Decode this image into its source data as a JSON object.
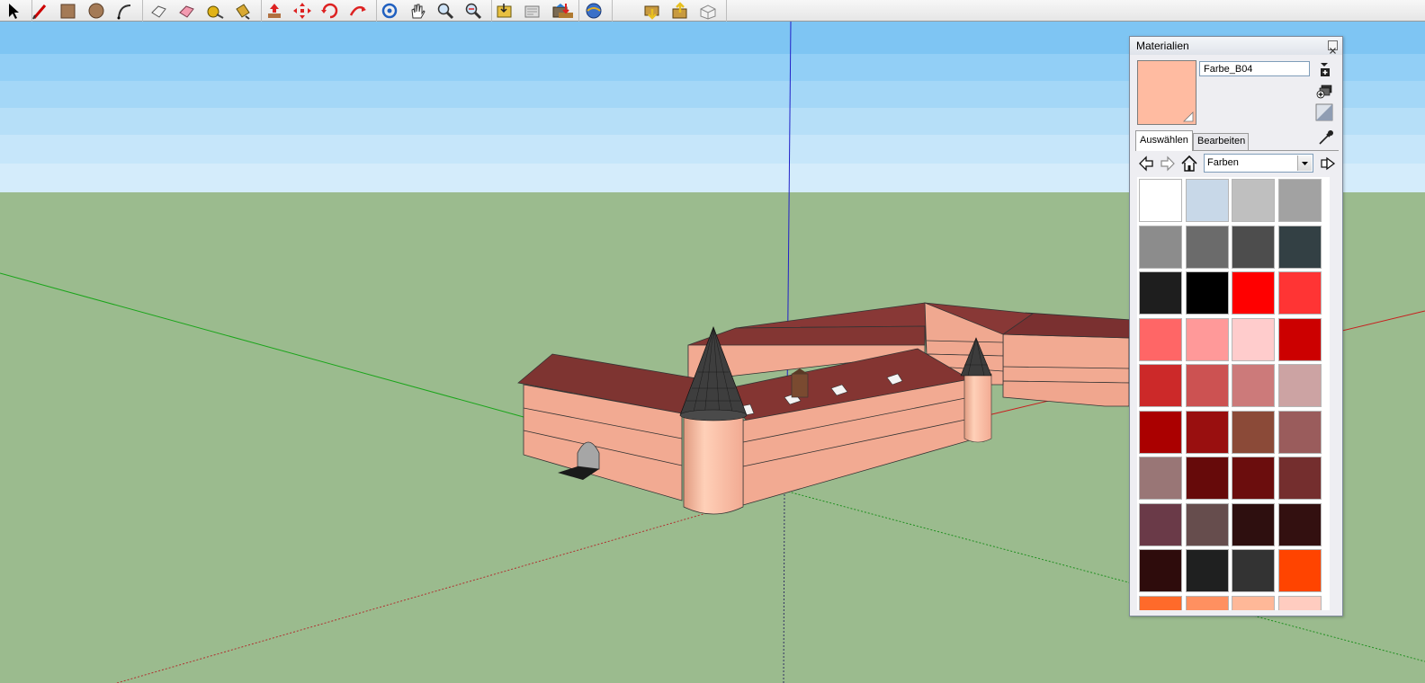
{
  "toolbar": {
    "icons": [
      "select-icon",
      "pencil-icon",
      "rectangle-icon",
      "circle-icon",
      "arc-icon",
      "eraser-icon",
      "eraser-pink-icon",
      "tape-measure-icon",
      "paint-bucket-icon",
      "push-pull-icon",
      "move-icon",
      "rotate-icon",
      "follow-me-icon",
      "orbit-icon",
      "pan-icon",
      "zoom-icon",
      "zoom-extents-icon",
      "get-models-icon",
      "share-model-icon",
      "place-model-icon",
      "get-photo-texture-icon",
      "google-earth-icon",
      "download-component-icon",
      "upload-component-icon",
      "component-icon"
    ]
  },
  "materials_panel": {
    "title": "Materialien",
    "current_material_name": "Farbe_B04",
    "current_color": "#ffbba1",
    "tabs": [
      {
        "label": "Auswählen",
        "active": true
      },
      {
        "label": "Bearbeiten",
        "active": false
      }
    ],
    "library": "Farben",
    "swatches": [
      "#ffffff",
      "#c8d8e8",
      "#bfbfbf",
      "#a2a2a2",
      "#8c8c8c",
      "#6b6b6b",
      "#4d4d4d",
      "#334044",
      "#1e1e1e",
      "#000000",
      "#ff0000",
      "#ff3434",
      "#ff6666",
      "#ff9999",
      "#ffcccc",
      "#cc0000",
      "#cc2929",
      "#cc5252",
      "#cc7a7a",
      "#cca3a3",
      "#aa0000",
      "#990f0f",
      "#8b4a38",
      "#9a5c5c",
      "#997676",
      "#660a0a",
      "#6b0d0d",
      "#742e2e",
      "#6a3a48",
      "#664d4d",
      "#2e0f0f",
      "#331010",
      "#2e0c0c",
      "#1f2020",
      "#333333",
      "#ff4400",
      "#ff6a2a",
      "#ff9060",
      "#ffb898",
      "#ffccc0"
    ]
  },
  "colors": {
    "sky_top": "#7fc6f4",
    "sky_bottom": "#d8eefb",
    "ground": "#9bbb8e",
    "wall": "#f2aa92",
    "roof": "#833633",
    "tower": "#ffc4a8",
    "spire": "#3e3e3e"
  }
}
